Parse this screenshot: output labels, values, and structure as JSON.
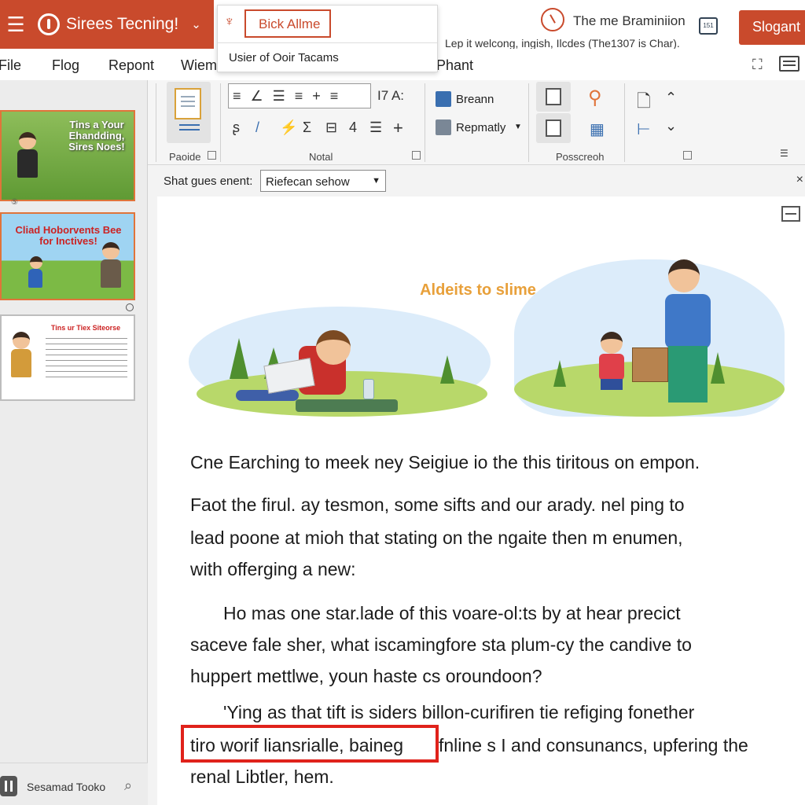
{
  "titlebar": {
    "app_name": "Sirees Tecning!",
    "dropdown": {
      "field_value": "Bick Allme",
      "item": "Usier of Ooir Tacams"
    },
    "right_title": "The me Braminiion",
    "subtitle": "Lep it welcong, ingish, Ilcdes (The1307 is Char).",
    "calendar_label": "151",
    "slogan_button": "Slogant"
  },
  "menu": {
    "items": [
      "File",
      "Flog",
      "Repont",
      "Wiem",
      "Phant"
    ]
  },
  "ribbon": {
    "groups": {
      "paste_label": "Paoide",
      "notal_label": "Notal",
      "posscreoh_label": "Posscreoh"
    },
    "font_label": "I7 A:",
    "number_tool": "4",
    "breann_label": "Breann",
    "repmatly_label": "Repmatly"
  },
  "format_bar": {
    "label": "Shat gues enent:",
    "select_value": "Riefecan sehow"
  },
  "thumbnails": [
    {
      "title": "Tins a Your Ehandding, Sires Noes!"
    },
    {
      "title": "Cliad Hoborvents Bee for Inctives!"
    },
    {
      "title": "Tins ur Tiex Siteorse"
    }
  ],
  "status": {
    "label": "Sesamad Tooko"
  },
  "slide": {
    "title": "Aldeits to slime",
    "paragraphs": [
      "Cne Earching to meek ney Seigiue io the this tiritous on empon.",
      "Faot the firul. ay tesmon, some sifts and our arady. nel ping to",
      "lead poone at mioh that stating on the ngaite then m enumen,",
      "with offerging a new:",
      "Ho mas one star.lade of this voare-ol:ts by at hear precict",
      "saceve fale sher, what iscamingfore sta plum-cy the candive to",
      "huppert mettlwe, youn haste cs oroundoon?",
      "'Ying as that tift is siders billon-curifiren tie refiging fonether",
      "tiro worif liansrialle, baineg",
      "fnline s I and consunancs, upfering the",
      "renal Libtler, hem."
    ]
  },
  "colors": {
    "brand": "#c94a2c",
    "slide_title": "#e8a03a",
    "highlight": "#e0221b"
  }
}
